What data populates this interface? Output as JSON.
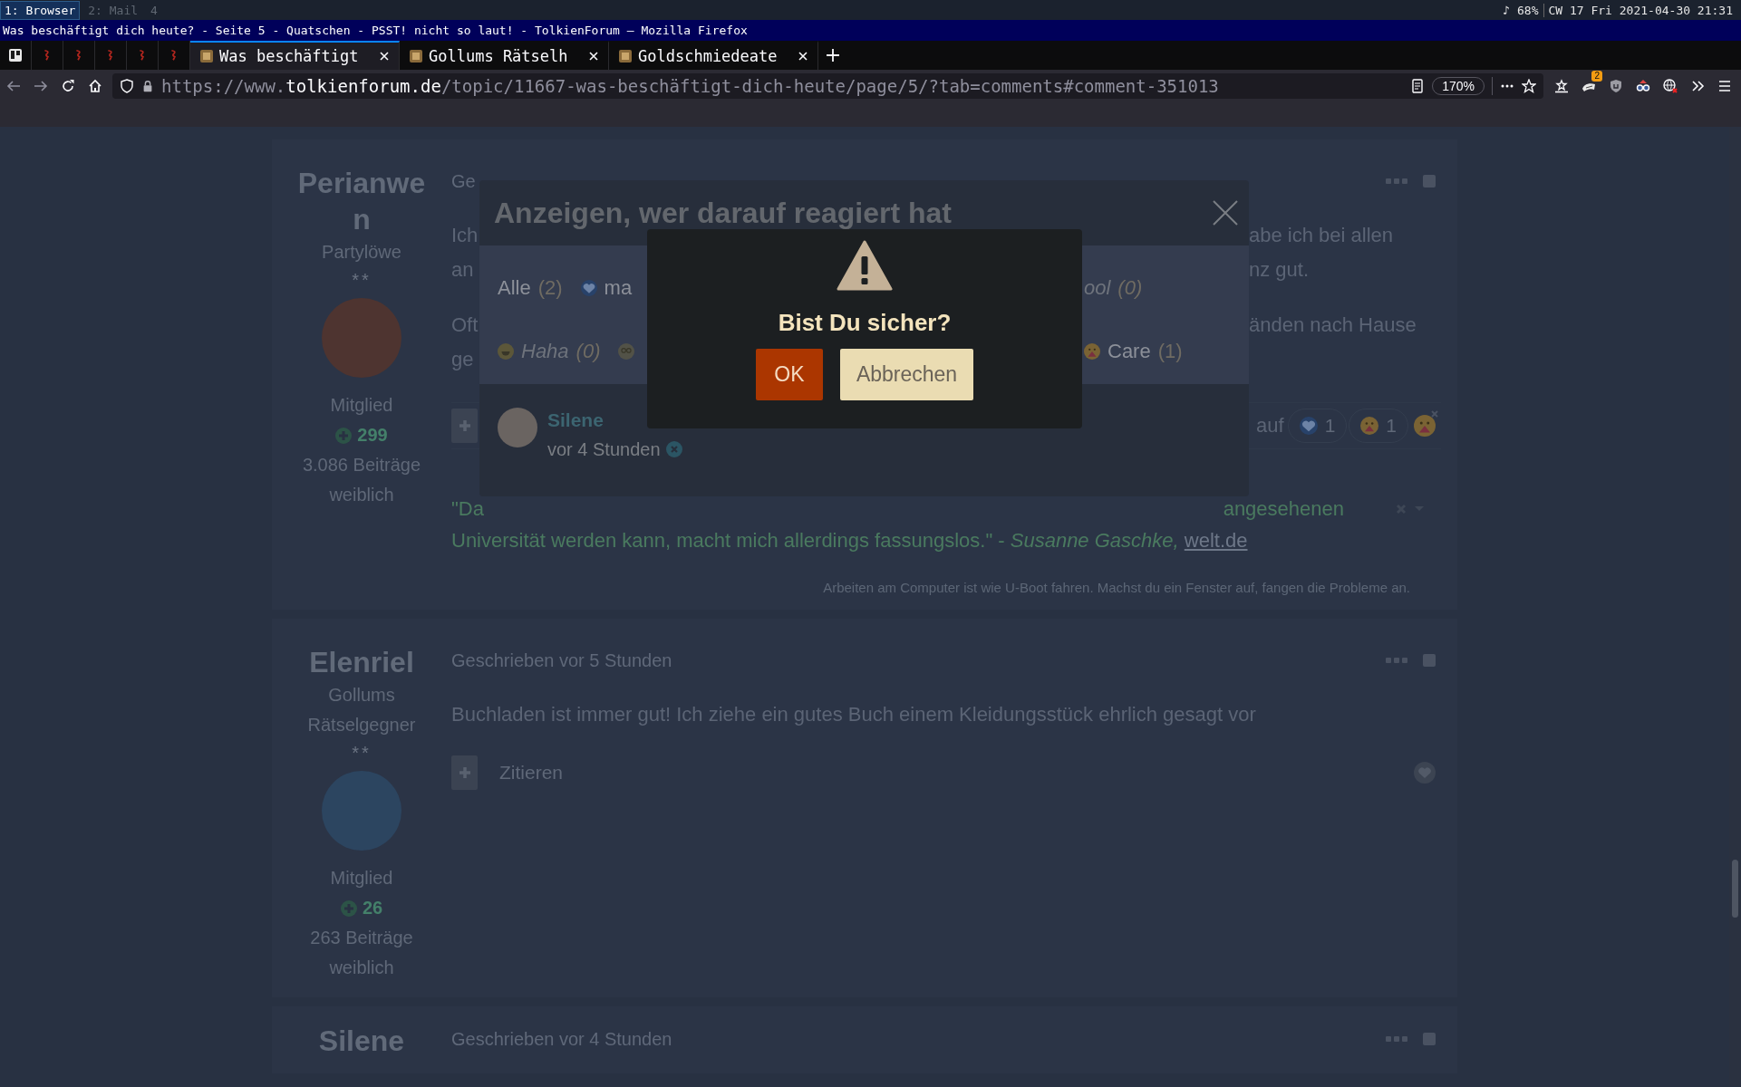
{
  "status_bar": {
    "workspaces": [
      {
        "label": "1: Browser",
        "selected": true
      },
      {
        "label": "2: Mail",
        "selected": false
      },
      {
        "label": "4",
        "selected": false
      }
    ],
    "volume": "♪ 68%",
    "clock": "CW 17 Fri 2021-04-30 21:31"
  },
  "window": {
    "title": "Was beschäftigt dich heute? - Seite 5 - Quatschen - PSST! nicht so laut! - TolkienForum — Mozilla Firefox"
  },
  "tabs": [
    {
      "kind": "board",
      "selected": false
    },
    {
      "kind": "forum",
      "selected": false
    },
    {
      "kind": "forum",
      "selected": false
    },
    {
      "kind": "forum",
      "selected": false
    },
    {
      "kind": "forum",
      "selected": false
    },
    {
      "kind": "forum",
      "selected": false
    },
    {
      "kind": "page",
      "label": "Was beschäftigt",
      "selected": true
    },
    {
      "kind": "page",
      "label": "Gollums Rätselh",
      "selected": false
    },
    {
      "kind": "page",
      "label": "Goldschmiedeate",
      "selected": false
    }
  ],
  "address_bar": {
    "prefix": "https://www.",
    "domain": "tolkienforum.de",
    "path": "/topic/11667-was-beschäftigt-dich-heute/page/5/?tab=comments#comment-351013",
    "zoom": "170%"
  },
  "toolbar": {
    "extension_badge": "2"
  },
  "posts": [
    {
      "author": {
        "name": "Perianwen",
        "rank": "Partylöwe",
        "rank_marks": "**",
        "group": "Mitglied",
        "reputation": "299",
        "post_count": "3.086 Beiträge",
        "gender": "weiblich"
      },
      "header": "Ge",
      "body": [
        {
          "lines": [
            {
              "left": "Ich",
              "right": "abe ich bei allen"
            },
            {
              "left": "an",
              "right": "nz gut."
            }
          ]
        },
        {
          "lines": [
            {
              "left": "Oft",
              "right": "änden nach Hause"
            },
            {
              "left": "ge"
            }
          ]
        }
      ],
      "selected": false,
      "actions": {
        "reactions_label": "auf",
        "reactions": [
          {
            "kind": "heart",
            "count": "1"
          },
          {
            "kind": "care",
            "count": "1"
          }
        ],
        "reacted": true
      },
      "quote": {
        "first": {
          "left": "\"Da",
          "right": "angesehenen"
        },
        "second": {
          "text": "Universität werden kann, macht mich allerdings fassungslos.\" - *Susanne Gaschke,*",
          "link": "welt.de"
        }
      },
      "signature": "Arbeiten am Computer ist wie U-Boot fahren. Machst du ein Fenster auf, fangen die Probleme an."
    },
    {
      "author": {
        "name": "Elenriel",
        "rank": "Gollums Rätselgegner",
        "rank_marks": "**",
        "group": "Mitglied",
        "reputation": "26",
        "post_count": "263 Beiträge",
        "gender": "weiblich"
      },
      "header": "Geschrieben vor 5 Stunden",
      "body": [
        {
          "lines": [
            {
              "text": "Buchladen ist immer gut! Ich ziehe ein gutes Buch einem Kleidungsstück ehrlich gesagt vor"
            }
          ]
        }
      ],
      "selected": false,
      "actions": {
        "quote_label": "Zitieren",
        "reacted": false
      }
    },
    {
      "author": {
        "name": "Silene"
      },
      "header": "Geschrieben vor 4 Stunden",
      "selected": false
    }
  ],
  "reactions_dialog": {
    "title": "Anzeigen, wer darauf reagiert hat",
    "filter_rows": [
      {
        "left": [
          {
            "kind": "all",
            "label": "Alle",
            "count": "(2)",
            "disabled": false
          },
          {
            "kind": "heart",
            "label": "ma",
            "disabled": false
          }
        ],
        "right": [
          {
            "kind": "plain",
            "label": "ool",
            "count": "(0)",
            "disabled": true
          }
        ]
      },
      {
        "left": [
          {
            "kind": "laugh",
            "label": "Haha",
            "count": "(0)",
            "disabled": true
          },
          {
            "kind": "confused",
            "disabled": true
          }
        ],
        "right": [
          {
            "kind": "care",
            "label": "Care",
            "count": "(1)",
            "disabled": false
          }
        ]
      }
    ],
    "reactors": [
      {
        "name": "Silene",
        "time": "vor 4 Stunden"
      }
    ]
  },
  "confirm_dialog": {
    "message": "Bist Du sicher?",
    "buttons": [
      {
        "kind": "primary",
        "label": "OK"
      },
      {
        "kind": "secondary",
        "label": "Abbrechen"
      }
    ]
  }
}
